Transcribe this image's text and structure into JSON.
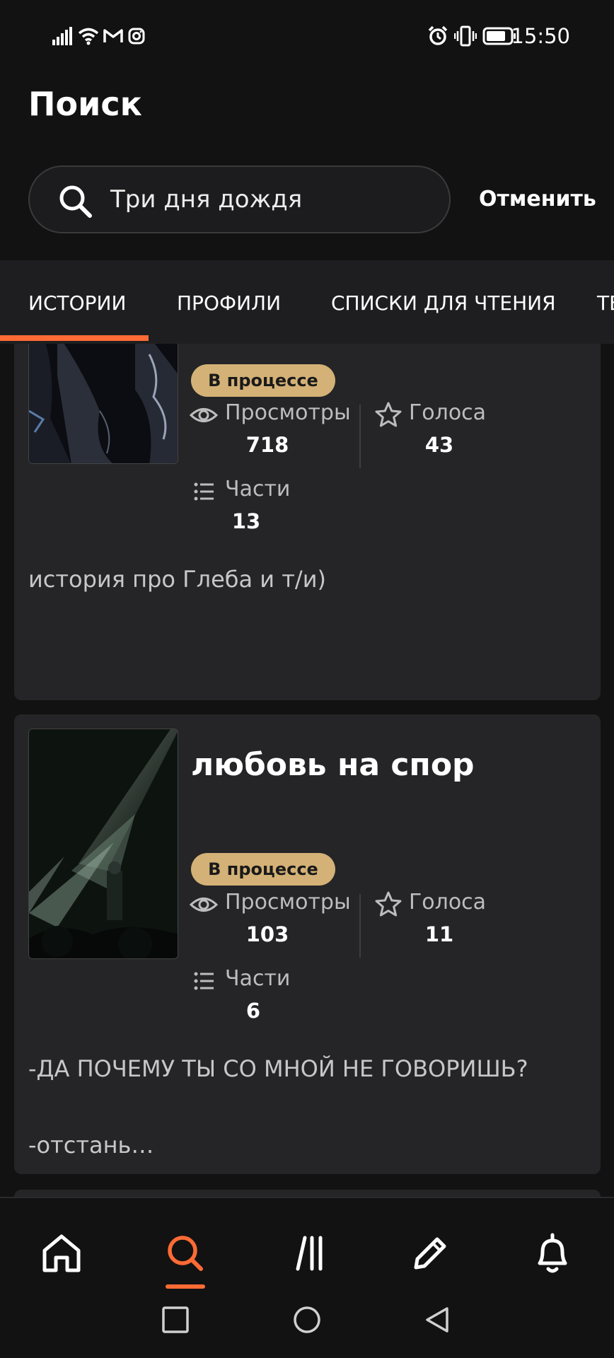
{
  "status_bar": {
    "time": "15:50"
  },
  "header": {
    "title": "Поиск"
  },
  "search": {
    "value": "Три дня дождя",
    "cancel_label": "Отменить"
  },
  "tabs": [
    {
      "label": "ИСТОРИИ",
      "active": true
    },
    {
      "label": "ПРОФИЛИ",
      "active": false
    },
    {
      "label": "СПИСКИ ДЛЯ ЧТЕНИЯ",
      "active": false
    },
    {
      "label": "ТЕ",
      "active": false
    }
  ],
  "accent_color": "#ff6b35",
  "badge_color": "#d4b176",
  "stories": [
    {
      "title": "",
      "status": "В процессе",
      "views_label": "Просмотры",
      "views": "718",
      "votes_label": "Голоса",
      "votes": "43",
      "parts_label": "Части",
      "parts": "13",
      "description_lines": [
        "история про Глеба и т/и)"
      ]
    },
    {
      "title": "любовь на спор",
      "status": "В процессе",
      "views_label": "Просмотры",
      "views": "103",
      "votes_label": "Голоса",
      "votes": "11",
      "parts_label": "Части",
      "parts": "6",
      "description_lines": [
        "-ДА ПОЧЕМУ ТЫ СО МНОЙ НЕ ГОВОРИШЬ?",
        "-отстань…"
      ]
    }
  ],
  "bottom_nav": [
    {
      "icon": "home-icon",
      "active": false
    },
    {
      "icon": "search-icon",
      "active": true
    },
    {
      "icon": "library-icon",
      "active": false
    },
    {
      "icon": "write-icon",
      "active": false
    },
    {
      "icon": "bell-icon",
      "active": false
    }
  ],
  "system_nav": [
    "recents-button",
    "home-button",
    "back-button"
  ]
}
